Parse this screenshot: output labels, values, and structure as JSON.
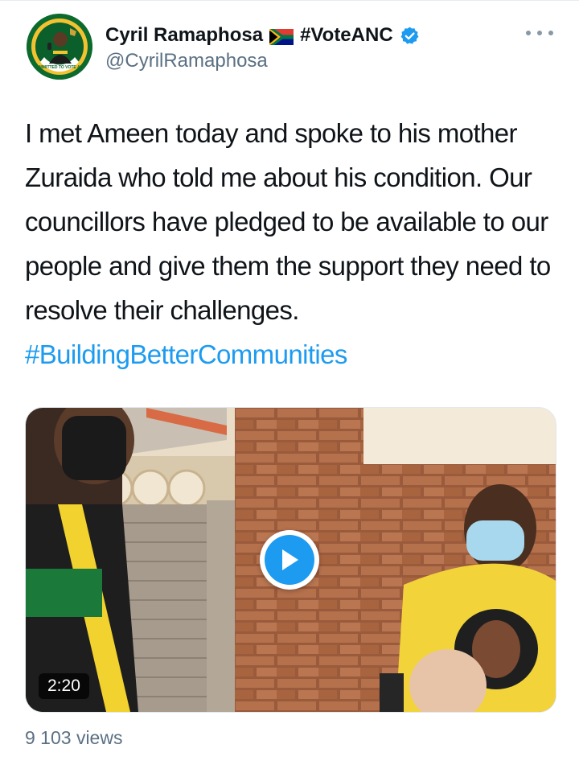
{
  "author": {
    "name": "Cyril Ramaphosa",
    "hashtag": "#VoteANC",
    "handle": "@CyrilRamaphosa",
    "avatar_ring_text": "COMMITTED TO VOTE ANC"
  },
  "tweet": {
    "text": "I met Ameen today and spoke to his mother Zuraida who told me about his condition. Our councillors have pledged to be available to our people and give them the support they need to resolve their challenges.",
    "hashtag": "#BuildingBetterCommunities"
  },
  "media": {
    "type": "video",
    "duration": "2:20"
  },
  "stats": {
    "views": "9 103 views"
  },
  "icons": {
    "flag": "south-africa-flag-icon",
    "verified": "verified-badge-icon",
    "more": "more-options-icon",
    "play": "play-icon"
  },
  "colors": {
    "link": "#1d9bf0",
    "secondary_text": "#5b7083",
    "verified": "#1d9bf0"
  }
}
